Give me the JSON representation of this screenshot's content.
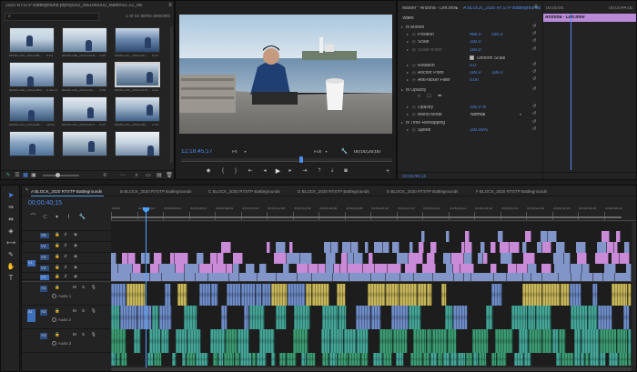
{
  "project": {
    "title": "2020 RTSTP Battleground.prproj\\002_MEDIA\\000_Maine\\01-22_MEDIA\\C300",
    "items_selected": "1 of 69 items selected",
    "search_placeholder": "",
    "thumbs": [
      {
        "label": "A005C249_200123B...",
        "dur": "5:23"
      },
      {
        "label": "A005C248_200123GR...",
        "dur": "3:09"
      },
      {
        "label": "A005C247_200123D...",
        "dur": "4:23"
      },
      {
        "label": "A005C246_200123BS...",
        "dur": "5:16:23"
      },
      {
        "label": "A005C245_200123S...",
        "dur": "2:06"
      },
      {
        "label": "A005C244_200123GR...",
        "dur": "3:23"
      },
      {
        "label": "A005C243_200123B...",
        "dur": "14:03"
      },
      {
        "label": "A005C242_200123EX...",
        "dur": "4:14"
      },
      {
        "label": "A005C241_200123B...",
        "dur": "2:15"
      },
      {
        "label": "",
        "dur": ""
      },
      {
        "label": "",
        "dur": ""
      },
      {
        "label": "",
        "dur": ""
      }
    ]
  },
  "program": {
    "timecode": "12;18;45;17",
    "fit_label": "Fit",
    "res_label": "Full",
    "duration": "00;00;26;00"
  },
  "effect_controls": {
    "title_master": "Master * Arizona - Left.mov",
    "title_clip": "A BLOCK_2020 RTSTP Battlegrounds",
    "clip_name": "Arizona - Left.mov",
    "tc_left": "00;00;00",
    "tc_right": "00;00;44;00",
    "section_video": "Video",
    "uniform_scale": "Uniform Scale",
    "footer_tc": "00;00;40;15",
    "rows": [
      {
        "label": "fx  Motion",
        "value": "",
        "value2": ""
      },
      {
        "label": "Position",
        "value": "468.0",
        "value2": "935.0"
      },
      {
        "label": "Scale",
        "value": "100.0",
        "value2": ""
      },
      {
        "label": "Scale Width",
        "value": "100.0",
        "value2": ""
      },
      {
        "label": "",
        "value": "",
        "value2": ""
      },
      {
        "label": "Rotation",
        "value": "0.0",
        "value2": ""
      },
      {
        "label": "Anchor Point",
        "value": "100.0",
        "value2": "100.0"
      },
      {
        "label": "Anti-flicker Filter",
        "value": "0.00",
        "value2": ""
      },
      {
        "label": "fx  Opacity",
        "value": "",
        "value2": ""
      },
      {
        "label": "",
        "value": "",
        "value2": ""
      },
      {
        "label": "Opacity",
        "value": "100.0 %",
        "value2": ""
      },
      {
        "label": "Blend Mode",
        "value": "Normal",
        "value2": ""
      },
      {
        "label": "fx  Time Remapping",
        "value": "",
        "value2": ""
      },
      {
        "label": "Speed",
        "value": "100.00%",
        "value2": ""
      }
    ]
  },
  "timeline": {
    "tabs": [
      "A BLOCK_2020 RTSTP Battlegrounds",
      "B BLOCK_2020 RTSTP Battlegrounds",
      "C BLOCK_2020 RTSTP Battlegrounds",
      "D BLOCK_2020 RTSTP Battlegrounds",
      "E BLOCK_2020 RTSTP Battlegrounds",
      "F BLOCK_2020 RTSTP Battlegrounds"
    ],
    "timecode": "00;00;40;15",
    "ruler": [
      "00;00",
      "00;00;02;00",
      "00;00;04;02",
      "00;00;06;02",
      "00;00;08;04",
      "00;00;10;04",
      "00;00;12;06",
      "00;00;14;06",
      "00;00;16;08",
      "00;00;18;08",
      "00;00;20;10",
      "00;00;22;10",
      "00;00;24;12",
      "00;00;26;12",
      "00;00;28;14",
      "00;00;30;14",
      "00;00;32;16",
      "00;00;34;16",
      "00;00;36;16",
      "00;00;38;18"
    ],
    "video_tracks": [
      "",
      "V5",
      "V4",
      "V3",
      "V2",
      "V1"
    ],
    "audio_tracks": [
      {
        "id": "A1",
        "name": "Audio 1"
      },
      {
        "id": "A2",
        "name": "Audio 2"
      },
      {
        "id": "A3",
        "name": "Audio 3"
      }
    ],
    "v1_source": "V1",
    "a1_source": "A1"
  },
  "colors": {
    "accent": "#2d8ceb",
    "video_clip": "#8295c8",
    "pink_clip": "#c98ad8",
    "audio_blue": "#6e8cc8",
    "audio_green": "#3c9a72",
    "audio_teal": "#44a597",
    "yellow_clip": "#c8b75a",
    "playhead": "#4ea1ff"
  }
}
